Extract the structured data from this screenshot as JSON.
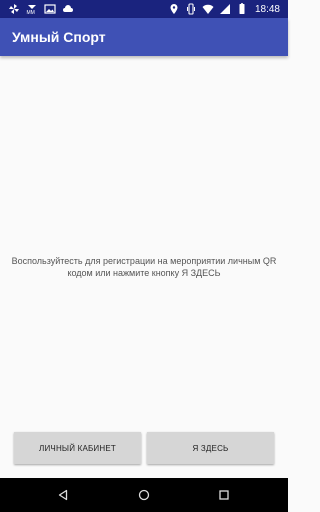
{
  "status_bar": {
    "time": "18:48",
    "left_icons": [
      "pinwheel-icon",
      "mm-icon",
      "image-icon",
      "cloud-icon"
    ],
    "right_icons": [
      "location-icon",
      "vibrate-icon",
      "wifi-icon",
      "signal-icon",
      "battery-icon"
    ]
  },
  "app_bar": {
    "title": "Умный Спорт",
    "color": "#3f51b5"
  },
  "main": {
    "message": "Воспользуйтесть для регистрации на мероприятии личным QR кодом или нажмите кнопку Я ЗДЕСЬ"
  },
  "buttons": {
    "cabinet_label": "ЛИЧНЫЙ КАБИНЕТ",
    "here_label": "Я ЗДЕСЬ"
  },
  "nav_bar": {
    "icons": [
      "back-icon",
      "home-icon",
      "recents-icon"
    ]
  }
}
